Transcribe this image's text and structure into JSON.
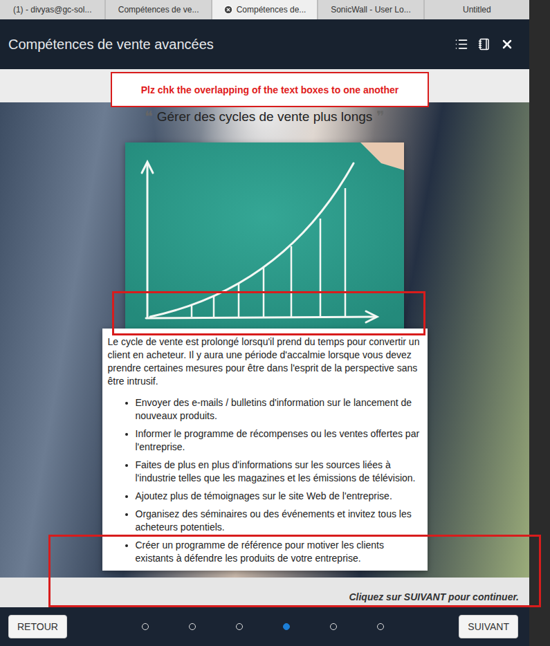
{
  "browser_tabs": [
    {
      "label": "(1) - divyas@gc-sol...",
      "selected": false
    },
    {
      "label": "Compétences de ve...",
      "selected": false
    },
    {
      "label": "Compétences de...",
      "selected": true
    },
    {
      "label": "SonicWall - User Lo...",
      "selected": false
    },
    {
      "label": "Untitled",
      "selected": false
    }
  ],
  "header": {
    "title": "Compétences de vente avancées"
  },
  "annotation": {
    "text": "Plz chk the overlapping of the text boxes to one another"
  },
  "slide": {
    "quote_open": "❝",
    "title": "Gérer des cycles de vente plus longs",
    "quote_close": "❞",
    "paragraph": "Le cycle de vente est prolongé lorsqu'il prend du temps pour convertir un client en acheteur. Il y aura une période d'accalmie lorsque vous devez prendre certaines mesures pour être dans l'esprit de la perspective sans être intrusif.",
    "bullets": [
      "Envoyer des e-mails / bulletins d'information sur le lancement de nouveaux produits.",
      "Informer le programme de récompenses ou les ventes offertes par l'entreprise.",
      "Faites de plus en plus d'informations sur les sources liées à l'industrie telles que les magazines et les émissions de télévision.",
      "Ajoutez plus de témoignages sur le site Web de l'entreprise.",
      "Organisez des séminaires ou des événements et invitez tous les acheteurs potentiels.",
      "Créer un programme de référence pour motiver les clients existants à défendre les produits de votre entreprise."
    ],
    "hint": "Cliquez sur SUIVANT pour continuer."
  },
  "footer": {
    "back": "RETOUR",
    "next": "SUIVANT",
    "pages": [
      {
        "selected": false
      },
      {
        "selected": false
      },
      {
        "selected": false
      },
      {
        "selected": true
      },
      {
        "selected": false
      },
      {
        "selected": false
      }
    ]
  }
}
